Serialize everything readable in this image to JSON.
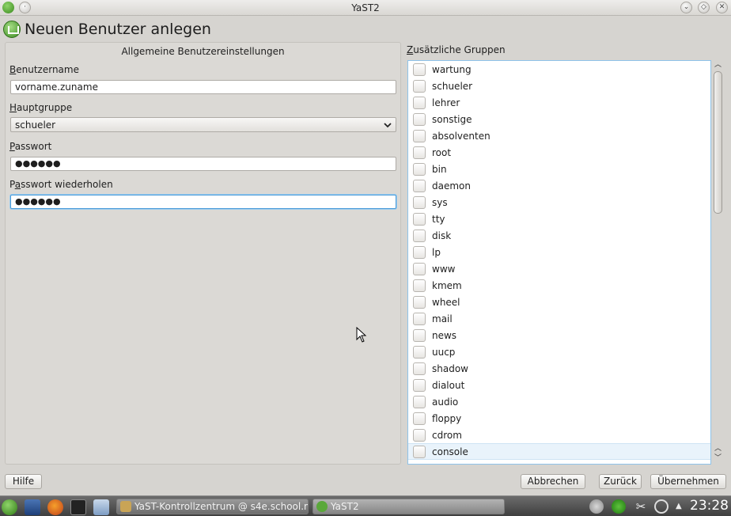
{
  "window": {
    "title": "YaST2"
  },
  "header": {
    "title": "Neuen Benutzer anlegen"
  },
  "form": {
    "panel_title": "Allgemeine Benutzereinstellungen",
    "username_label_first": "B",
    "username_label_rest": "enutzername",
    "username_value": "vorname.zuname",
    "group_label_first": "H",
    "group_label_rest": "auptgruppe",
    "group_value": "schueler",
    "password_label_first": "P",
    "password_label_rest": "asswort",
    "password_value": "●●●●●●",
    "password_repeat_label_pre": "P",
    "password_repeat_label_under": "a",
    "password_repeat_label_rest": "sswort wiederholen",
    "password_repeat_value": "●●●●●●"
  },
  "groups": {
    "label_first": "Z",
    "label_rest": "usätzliche Gruppen",
    "items": [
      "wartung",
      "schueler",
      "lehrer",
      "sonstige",
      "absolventen",
      "root",
      "bin",
      "daemon",
      "sys",
      "tty",
      "disk",
      "lp",
      "www",
      "kmem",
      "wheel",
      "mail",
      "news",
      "uucp",
      "shadow",
      "dialout",
      "audio",
      "floppy",
      "cdrom",
      "console"
    ],
    "highlighted": "console"
  },
  "buttons": {
    "help": "Hilfe",
    "cancel": "Abbrechen",
    "back": "Zurück",
    "apply": "Übernehmen"
  },
  "taskbar": {
    "task1": "YaST-Kontrollzentrum @ s4e.school.ne",
    "task2": "YaST2",
    "clock": "23:28"
  },
  "colors": {
    "accent": "#4a9bd8",
    "yast_green": "#3c8c22",
    "highlight_row": "#e9f3fb"
  }
}
